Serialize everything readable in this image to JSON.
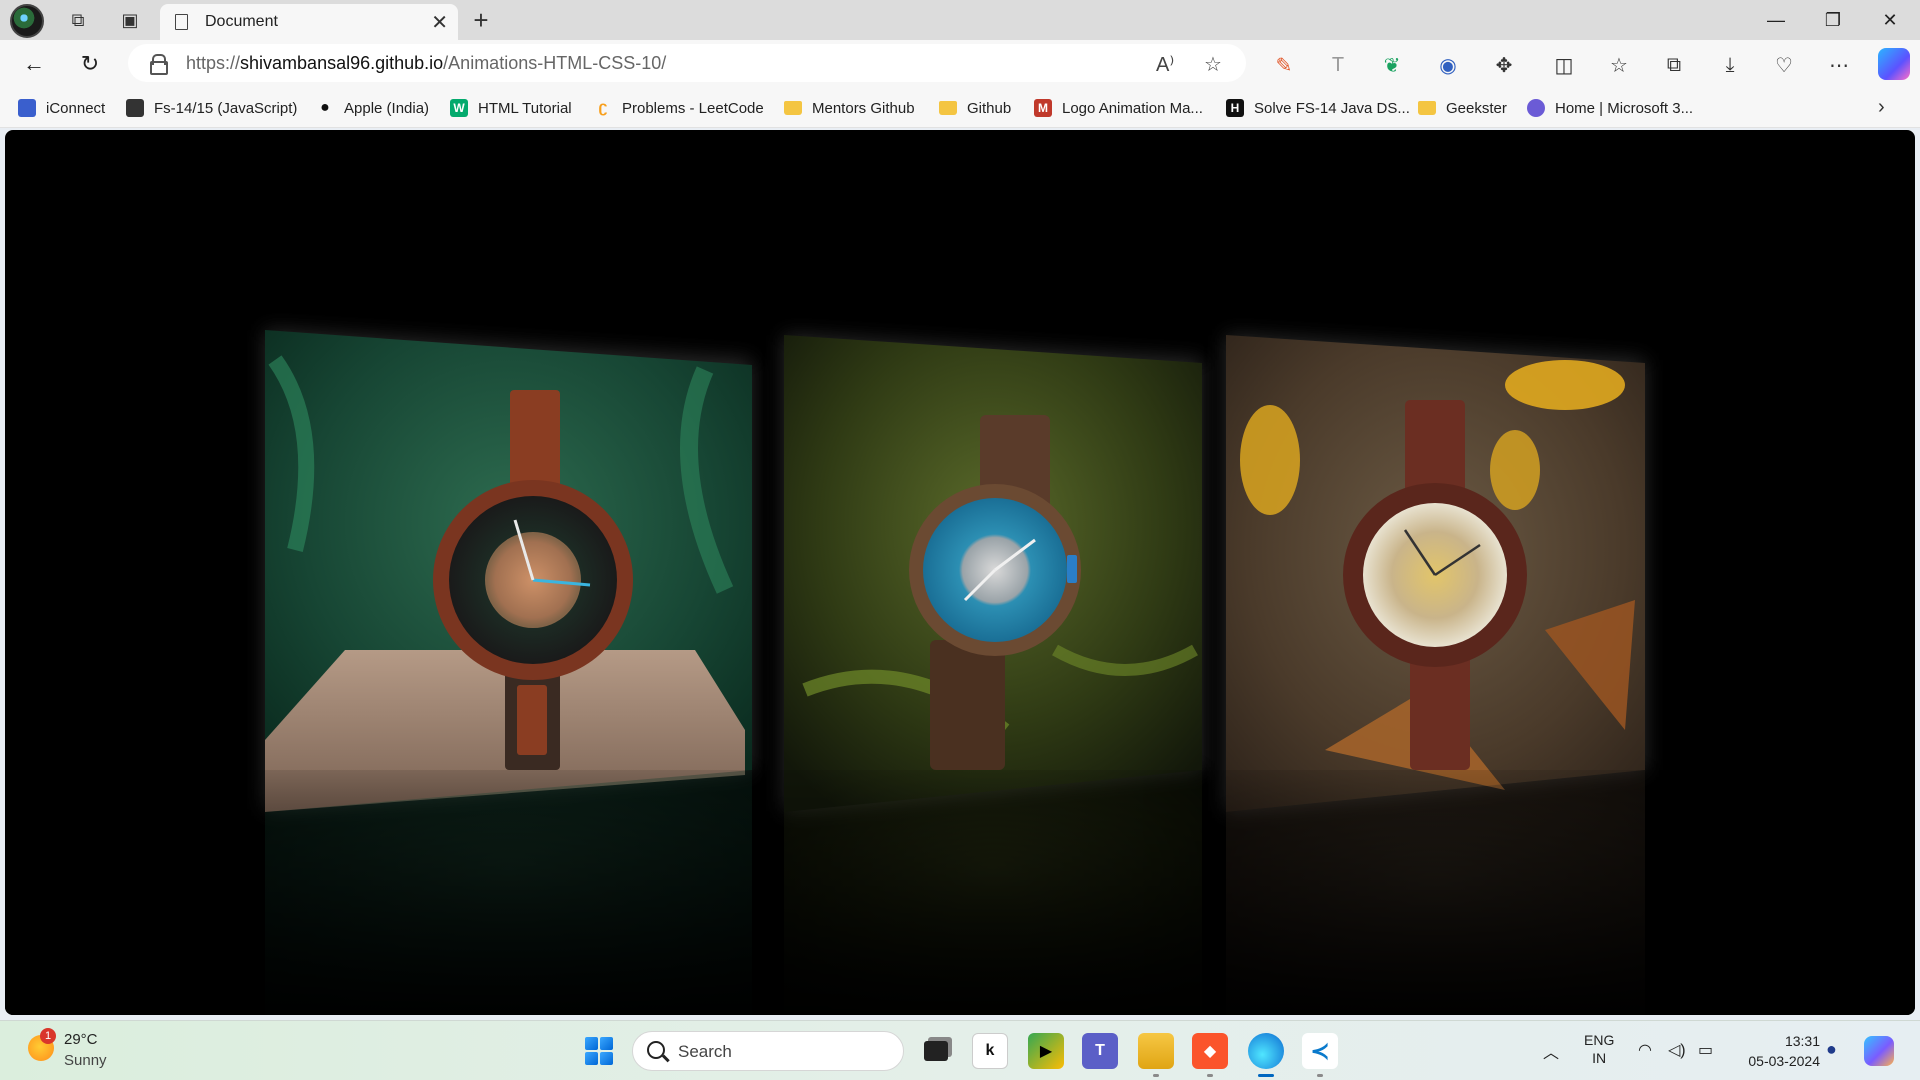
{
  "browser": {
    "tab_title": "Document",
    "tab_close": "✕",
    "new_tab": "+",
    "url_scheme": "https://",
    "url_host": "shivambansal96.github.io",
    "url_path": "/Animations-HTML-CSS-10/"
  },
  "window_controls": {
    "minimize": "—",
    "restore": "❐",
    "close": "✕"
  },
  "nav": {
    "back": "←",
    "refresh": "↻"
  },
  "favorites": [
    {
      "label": "iConnect",
      "icon": "iconnect-icon",
      "color": "#3a5fcd"
    },
    {
      "label": "Fs-14/15 (JavaScript)",
      "icon": "profile-icon",
      "color": "#333333"
    },
    {
      "label": "Apple (India)",
      "icon": "apple-icon",
      "color": "#111111"
    },
    {
      "label": "HTML Tutorial",
      "icon": "w3schools-icon",
      "color": "#04aa6d"
    },
    {
      "label": "Problems - LeetCode",
      "icon": "leetcode-icon",
      "color": "#f89f1b"
    },
    {
      "label": "Mentors Github",
      "icon": "folder-icon",
      "color": "#f4c542"
    },
    {
      "label": "Github",
      "icon": "folder-icon",
      "color": "#f4c542"
    },
    {
      "label": "Logo Animation Ma...",
      "icon": "logo-animation-icon",
      "color": "#c0392b"
    },
    {
      "label": "Solve FS-14 Java DS...",
      "icon": "hackerrank-icon",
      "color": "#111111"
    },
    {
      "label": "Geekster",
      "icon": "folder-icon",
      "color": "#f4c542"
    },
    {
      "label": "Home | Microsoft 3...",
      "icon": "microsoft365-icon",
      "color": "#6b5bd6"
    }
  ],
  "gallery": {
    "cards": [
      {
        "name": "watch-card-forest",
        "description": ""
      },
      {
        "name": "watch-card-blue",
        "description": ""
      },
      {
        "name": "watch-card-autumn",
        "description": ""
      }
    ]
  },
  "taskbar": {
    "weather_temp": "29°C",
    "weather_condition": "Sunny",
    "weather_badge": "1",
    "search_placeholder": "Search",
    "lang_line1": "ENG",
    "lang_line2": "IN",
    "time": "13:31",
    "date": "05-03-2024"
  }
}
